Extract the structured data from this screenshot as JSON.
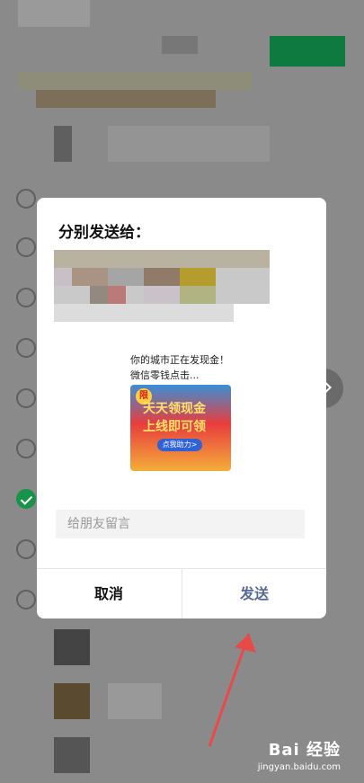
{
  "dialog": {
    "title": "分别发送给：",
    "share_card": {
      "text": "你的城市正在发现金！微信零钱点击...",
      "promo_line1": "天天领现金",
      "promo_line2": "上线即可领",
      "promo_button": "点我助力>",
      "badge": "限"
    },
    "comment_placeholder": "给朋友留言",
    "cancel_label": "取消",
    "send_label": "发送"
  },
  "watermark": {
    "logo": "Bai 经验",
    "url": "jingyan.baidu.com"
  },
  "colors": {
    "overlay": "#8a8a8a",
    "send_text": "#576b95",
    "check_green": "#17934a",
    "arrow_red": "#e84a4a"
  }
}
